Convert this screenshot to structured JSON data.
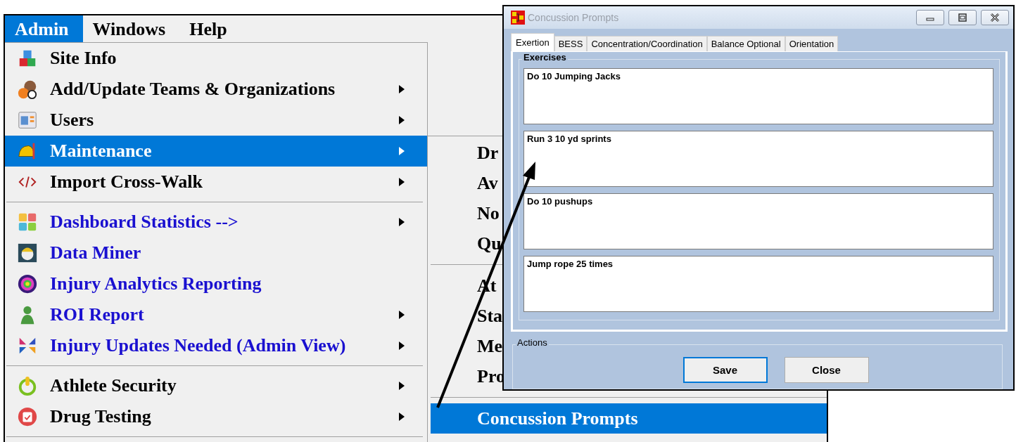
{
  "menu_bar": [
    {
      "label": "Admin",
      "selected": true
    },
    {
      "label": "Windows",
      "selected": false
    },
    {
      "label": "Help",
      "selected": false
    }
  ],
  "admin_menu": {
    "items": [
      {
        "kind": "item",
        "label": "Site Info",
        "color": "#000000",
        "selected": false,
        "has_submenu": false
      },
      {
        "kind": "item",
        "label": "Add/Update Teams & Organizations",
        "color": "#000000",
        "selected": false,
        "has_submenu": true
      },
      {
        "kind": "item",
        "label": "Users",
        "color": "#000000",
        "selected": false,
        "has_submenu": true
      },
      {
        "kind": "item",
        "label": "Maintenance",
        "color": "#ffffff",
        "selected": true,
        "has_submenu": true
      },
      {
        "kind": "item",
        "label": "Import Cross-Walk",
        "color": "#000000",
        "selected": false,
        "has_submenu": true
      },
      {
        "kind": "separator"
      },
      {
        "kind": "item",
        "label": "Dashboard Statistics -->",
        "color": "#1a10d0",
        "selected": false,
        "has_submenu": true
      },
      {
        "kind": "item",
        "label": "Data Miner",
        "color": "#1a10d0",
        "selected": false,
        "has_submenu": false
      },
      {
        "kind": "item",
        "label": "Injury Analytics Reporting",
        "color": "#1a10d0",
        "selected": false,
        "has_submenu": false
      },
      {
        "kind": "item",
        "label": "ROI Report",
        "color": "#1a10d0",
        "selected": false,
        "has_submenu": true
      },
      {
        "kind": "item",
        "label": "Injury Updates Needed (Admin View)",
        "color": "#1a10d0",
        "selected": false,
        "has_submenu": true
      },
      {
        "kind": "separator"
      },
      {
        "kind": "item",
        "label": "Athlete Security",
        "color": "#000000",
        "selected": false,
        "has_submenu": true
      },
      {
        "kind": "item",
        "label": "Drug Testing",
        "color": "#000000",
        "selected": false,
        "has_submenu": true
      },
      {
        "kind": "separator"
      }
    ]
  },
  "maintenance_submenu": {
    "items": [
      {
        "kind": "item",
        "label": "Dr",
        "selected": false
      },
      {
        "kind": "item",
        "label": "Av",
        "selected": false
      },
      {
        "kind": "item",
        "label": "No",
        "selected": false
      },
      {
        "kind": "item",
        "label": "Qu",
        "selected": false
      },
      {
        "kind": "separator"
      },
      {
        "kind": "item",
        "label": "At",
        "selected": false
      },
      {
        "kind": "item",
        "label": "Sta",
        "selected": false
      },
      {
        "kind": "item",
        "label": "Me",
        "selected": false
      },
      {
        "kind": "item",
        "label": "Pro",
        "selected": false
      },
      {
        "kind": "separator"
      },
      {
        "kind": "item",
        "label": "Concussion Prompts",
        "selected": true
      }
    ]
  },
  "dialog": {
    "title": "Concussion Prompts",
    "tabs": [
      {
        "label": "Exertion",
        "selected": true
      },
      {
        "label": "BESS",
        "selected": false
      },
      {
        "label": "Concentration/Coordination",
        "selected": false
      },
      {
        "label": "Balance Optional",
        "selected": false
      },
      {
        "label": "Orientation",
        "selected": false
      }
    ],
    "exercises_group": {
      "label": "Exercises",
      "fields": [
        {
          "value": "Do 10 Jumping Jacks"
        },
        {
          "value": "Run 3 10 yd sprints"
        },
        {
          "value": "Do 10 pushups"
        },
        {
          "value": "Jump rope 25 times"
        }
      ]
    },
    "actions_group": {
      "label": "Actions",
      "buttons": [
        {
          "label": "Save",
          "focused": true
        },
        {
          "label": "Close",
          "focused": false
        }
      ]
    }
  }
}
